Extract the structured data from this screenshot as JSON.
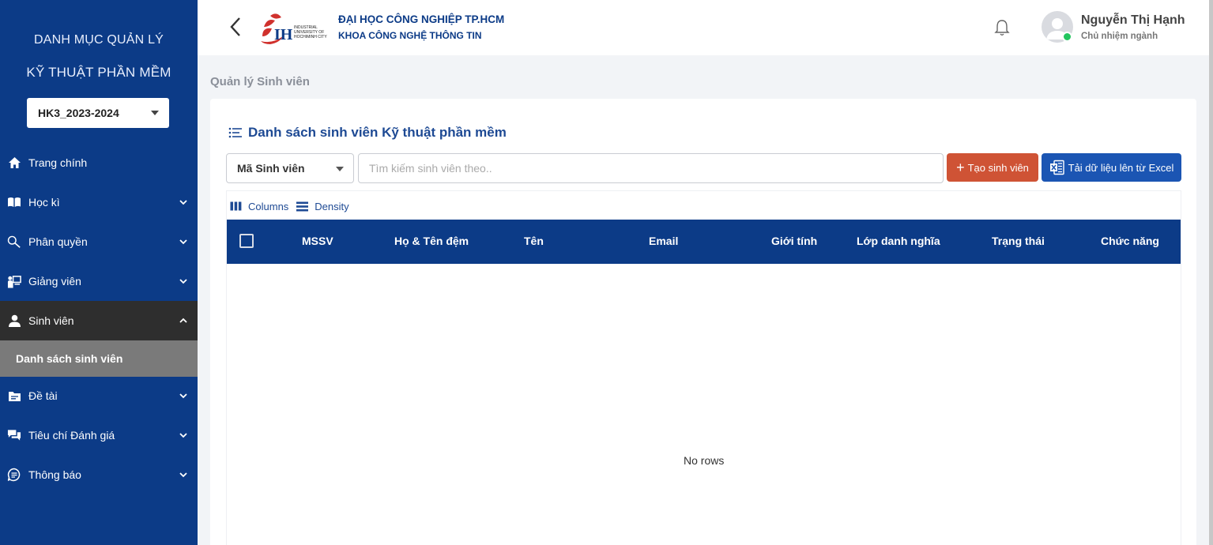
{
  "sidebar": {
    "title_line1": "DANH MỤC QUẢN LÝ",
    "title_line2": "KỸ THUẬT PHẦN MỀM",
    "semester": "HK3_2023-2024",
    "items": [
      {
        "label": "Trang chính",
        "icon": "home-icon"
      },
      {
        "label": "Học kì",
        "icon": "book-icon"
      },
      {
        "label": "Phân quyền",
        "icon": "key-search-icon"
      },
      {
        "label": "Giảng viên",
        "icon": "teacher-icon"
      },
      {
        "label": "Sinh viên",
        "icon": "student-icon"
      },
      {
        "label": "Đề tài",
        "icon": "folder-icon"
      },
      {
        "label": "Tiêu chí Đánh giá",
        "icon": "chat-icon"
      },
      {
        "label": "Thông báo",
        "icon": "message-icon"
      }
    ],
    "sub_item": "Danh sách sinh viên"
  },
  "header": {
    "logo_text_top": "INDUSTRIAL",
    "logo_text_mid": "UNIVERSITY OF",
    "logo_text_bot": "HOCHIMINH CITY",
    "university": "ĐẠI HỌC CÔNG NGHIỆP TP.HCM",
    "faculty": "KHOA CÔNG NGHỆ THÔNG TIN",
    "user_name": "Nguyễn Thị Hạnh",
    "user_role": "Chủ nhiệm ngành"
  },
  "page": {
    "breadcrumb": "Quản lý Sinh viên",
    "card_title": "Danh sách sinh viên Kỹ thuật phần mềm",
    "filter_value": "Mã Sinh viên",
    "search_placeholder": "Tìm kiếm sinh viên theo..",
    "create_button": "Tạo sinh viên",
    "excel_button": "Tải dữ liệu lên từ Excel",
    "columns_button": "Columns",
    "density_button": "Density",
    "columns": [
      "MSSV",
      "Họ & Tên đệm",
      "Tên",
      "Email",
      "Giới tính",
      "Lớp danh nghĩa",
      "Trạng thái",
      "Chức năng"
    ],
    "empty_text": "No rows"
  },
  "colors": {
    "primary": "#0c3b87",
    "accent_red": "#cf5335",
    "excel_blue": "#1b55b3",
    "online": "#22c55e"
  }
}
